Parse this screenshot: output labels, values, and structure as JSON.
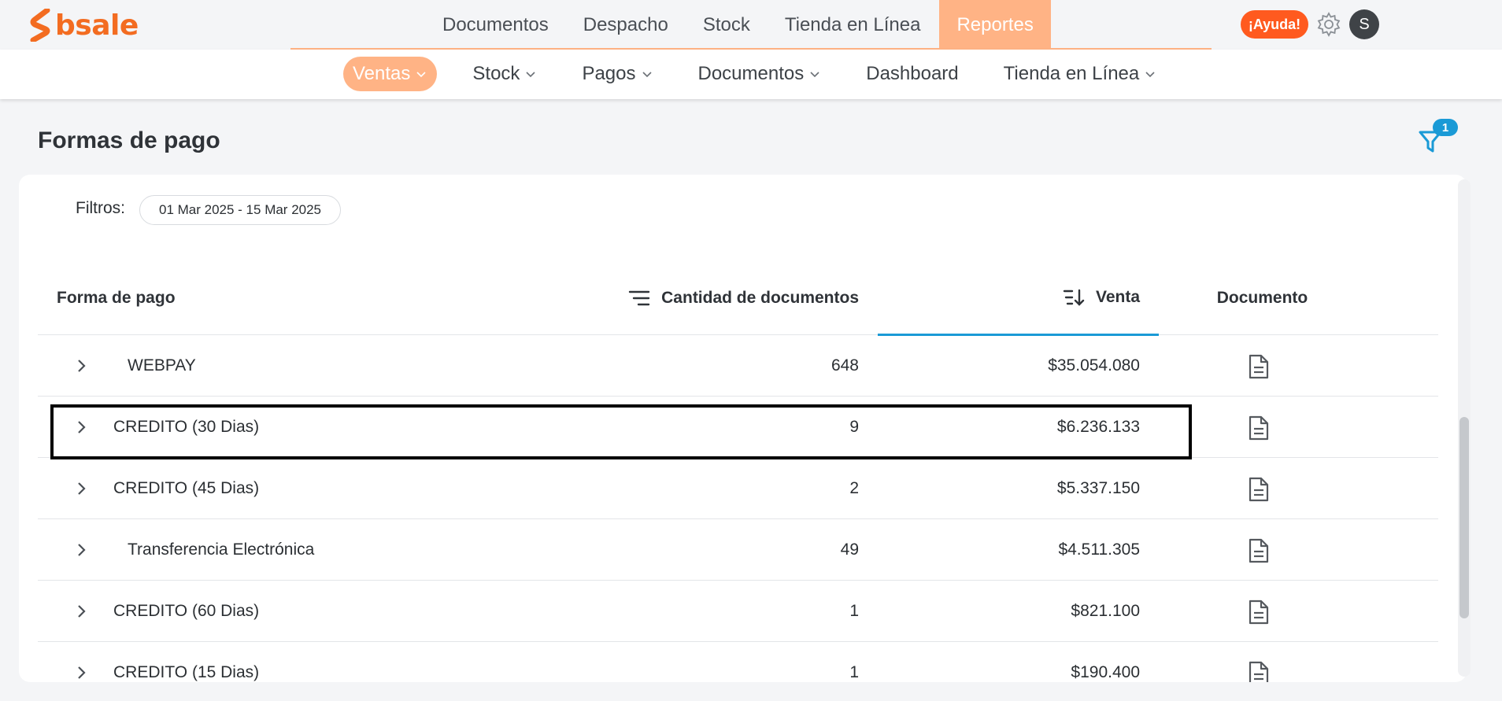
{
  "brand": {
    "logo_text": "bsale",
    "accent": "#f36c21",
    "nav_active_color": "#ffb385",
    "link_color": "#1a9ad6"
  },
  "main_nav": {
    "items": [
      {
        "label": "Documentos"
      },
      {
        "label": "Despacho"
      },
      {
        "label": "Stock"
      },
      {
        "label": "Tienda en Línea"
      },
      {
        "label": "Reportes",
        "active": true
      }
    ]
  },
  "header_actions": {
    "help_label": "¡Ayuda!",
    "avatar_initial": "S",
    "settings_icon": "gear-icon"
  },
  "sub_nav": {
    "items": [
      {
        "label": "Ventas",
        "active": true,
        "dropdown": true
      },
      {
        "label": "Stock",
        "dropdown": true
      },
      {
        "label": "Pagos",
        "dropdown": true
      },
      {
        "label": "Documentos",
        "dropdown": true
      },
      {
        "label": "Dashboard",
        "dropdown": false
      },
      {
        "label": "Tienda en Línea",
        "dropdown": true
      }
    ]
  },
  "page": {
    "title": "Formas de pago",
    "filter_count": "1"
  },
  "filters": {
    "label": "Filtros:",
    "date_range": "01 Mar 2025 - 15 Mar 2025"
  },
  "table": {
    "columns": {
      "forma_de_pago": "Forma de pago",
      "cantidad": "Cantidad de documentos",
      "venta": "Venta",
      "documento": "Documento"
    },
    "sorted_column": "venta",
    "rows": [
      {
        "name": "WEBPAY",
        "cantidad": "648",
        "venta": "$35.054.080"
      },
      {
        "name": "CREDITO (30 Dias)",
        "cantidad": "9",
        "venta": "$6.236.133",
        "highlighted": true
      },
      {
        "name": "CREDITO (45 Dias)",
        "cantidad": "2",
        "venta": "$5.337.150"
      },
      {
        "name": "Transferencia Electrónica",
        "cantidad": "49",
        "venta": "$4.511.305"
      },
      {
        "name": "CREDITO (60 Dias)",
        "cantidad": "1",
        "venta": "$821.100"
      },
      {
        "name": "CREDITO (15 Dias)",
        "cantidad": "1",
        "venta": "$190.400"
      }
    ]
  }
}
